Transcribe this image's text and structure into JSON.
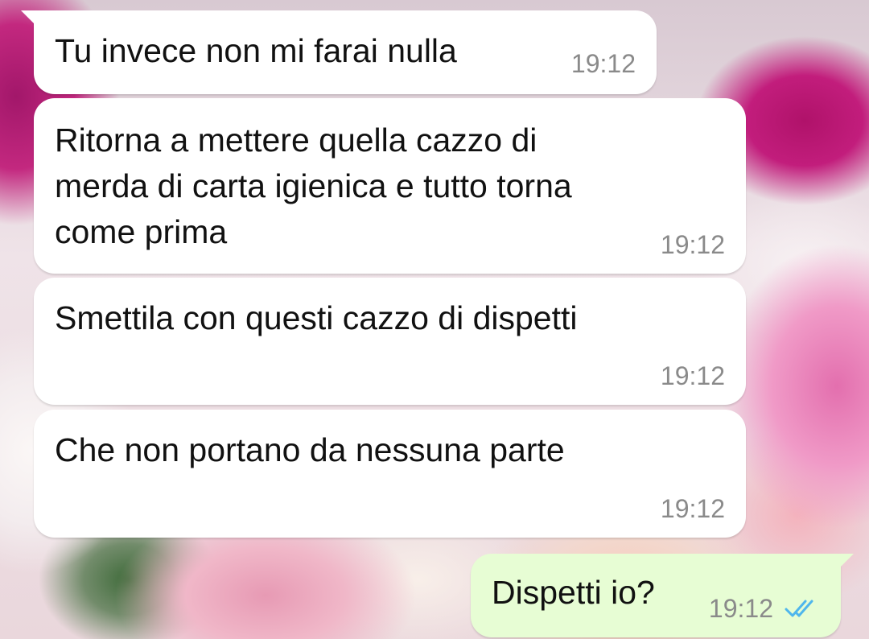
{
  "chat": {
    "messages": [
      {
        "direction": "incoming",
        "text": "Tu invece non mi farai nulla",
        "time": "19:12"
      },
      {
        "direction": "incoming",
        "text": "Ritorna a mettere quella cazzo di\nmerda di carta igienica e tutto torna\ncome prima",
        "time": "19:12"
      },
      {
        "direction": "incoming",
        "text": "Smettila con questi cazzo di dispetti",
        "time": "19:12"
      },
      {
        "direction": "incoming",
        "text": "Che non portano da nessuna parte",
        "time": "19:12"
      },
      {
        "direction": "outgoing",
        "text": "Dispetti io?",
        "time": "19:12",
        "status": "read",
        "status_icon": "double-check-icon"
      }
    ]
  },
  "colors": {
    "incoming_bubble": "#ffffff",
    "outgoing_bubble": "#e7fdd4",
    "read_ticks": "#4fb6ec",
    "timestamp": "#8a8a8a"
  }
}
